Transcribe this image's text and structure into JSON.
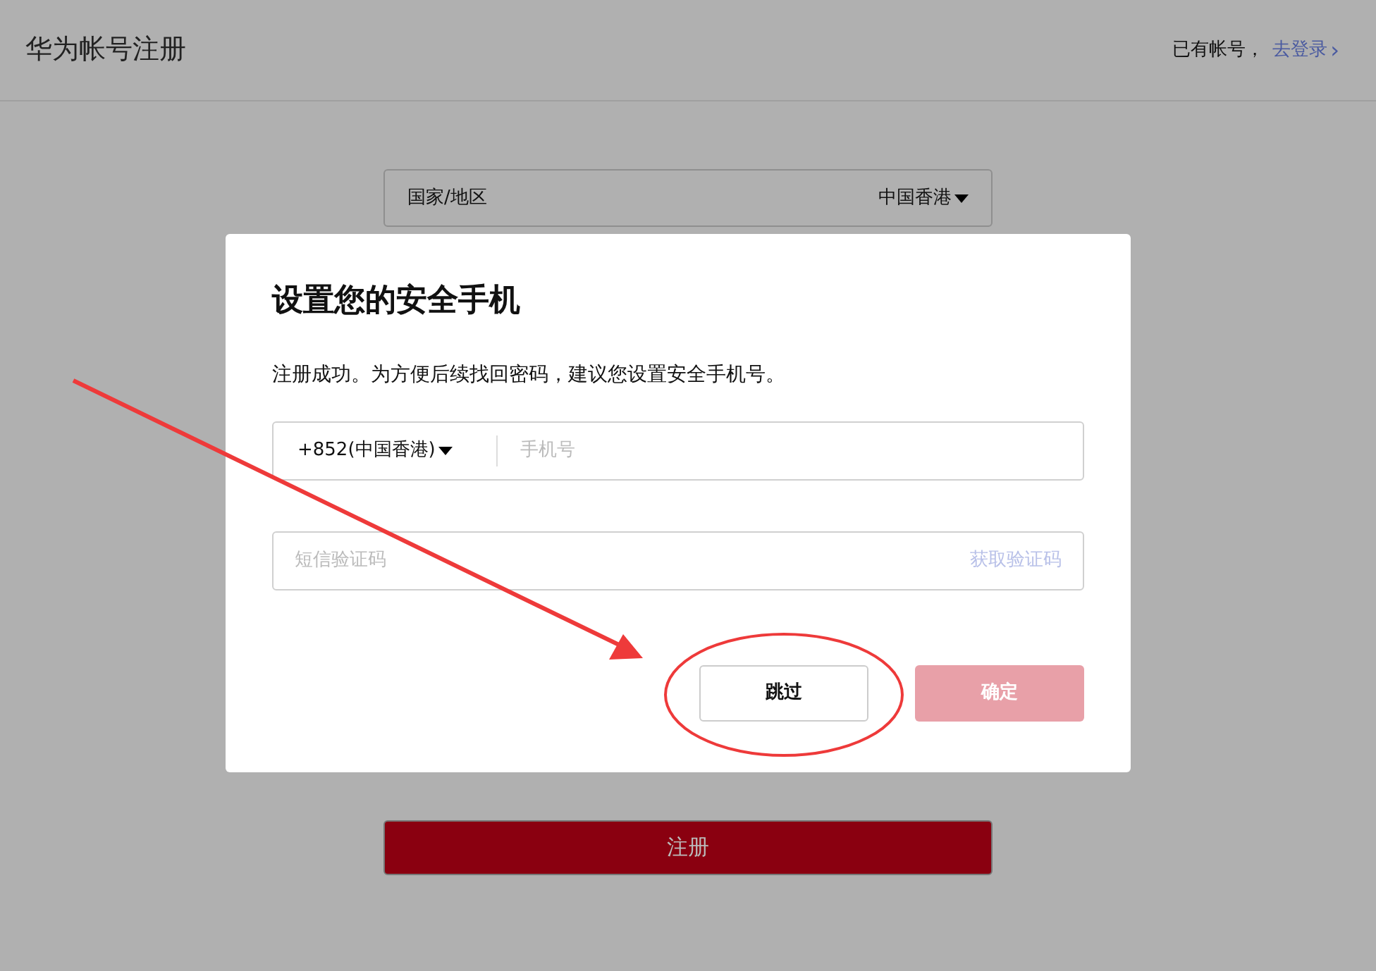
{
  "header": {
    "title": "华为帐号注册",
    "login_prompt": "已有帐号，",
    "login_link": "去登录",
    "login_arrow": "›"
  },
  "form": {
    "country_label": "国家/地区",
    "country_value": "中国香港",
    "register_button": "注册"
  },
  "dialog": {
    "title": "设置您的安全手机",
    "message": "注册成功。为方便后续找回密码，建议您设置安全手机号。",
    "phone_code": "+852(中国香港)",
    "phone_placeholder": "手机号",
    "sms_placeholder": "短信验证码",
    "get_code": "获取验证码",
    "buttons": [
      {
        "label": "跳过",
        "kind": "secondary",
        "disabled": false
      },
      {
        "label": "确定",
        "kind": "primary",
        "disabled": true
      }
    ]
  }
}
